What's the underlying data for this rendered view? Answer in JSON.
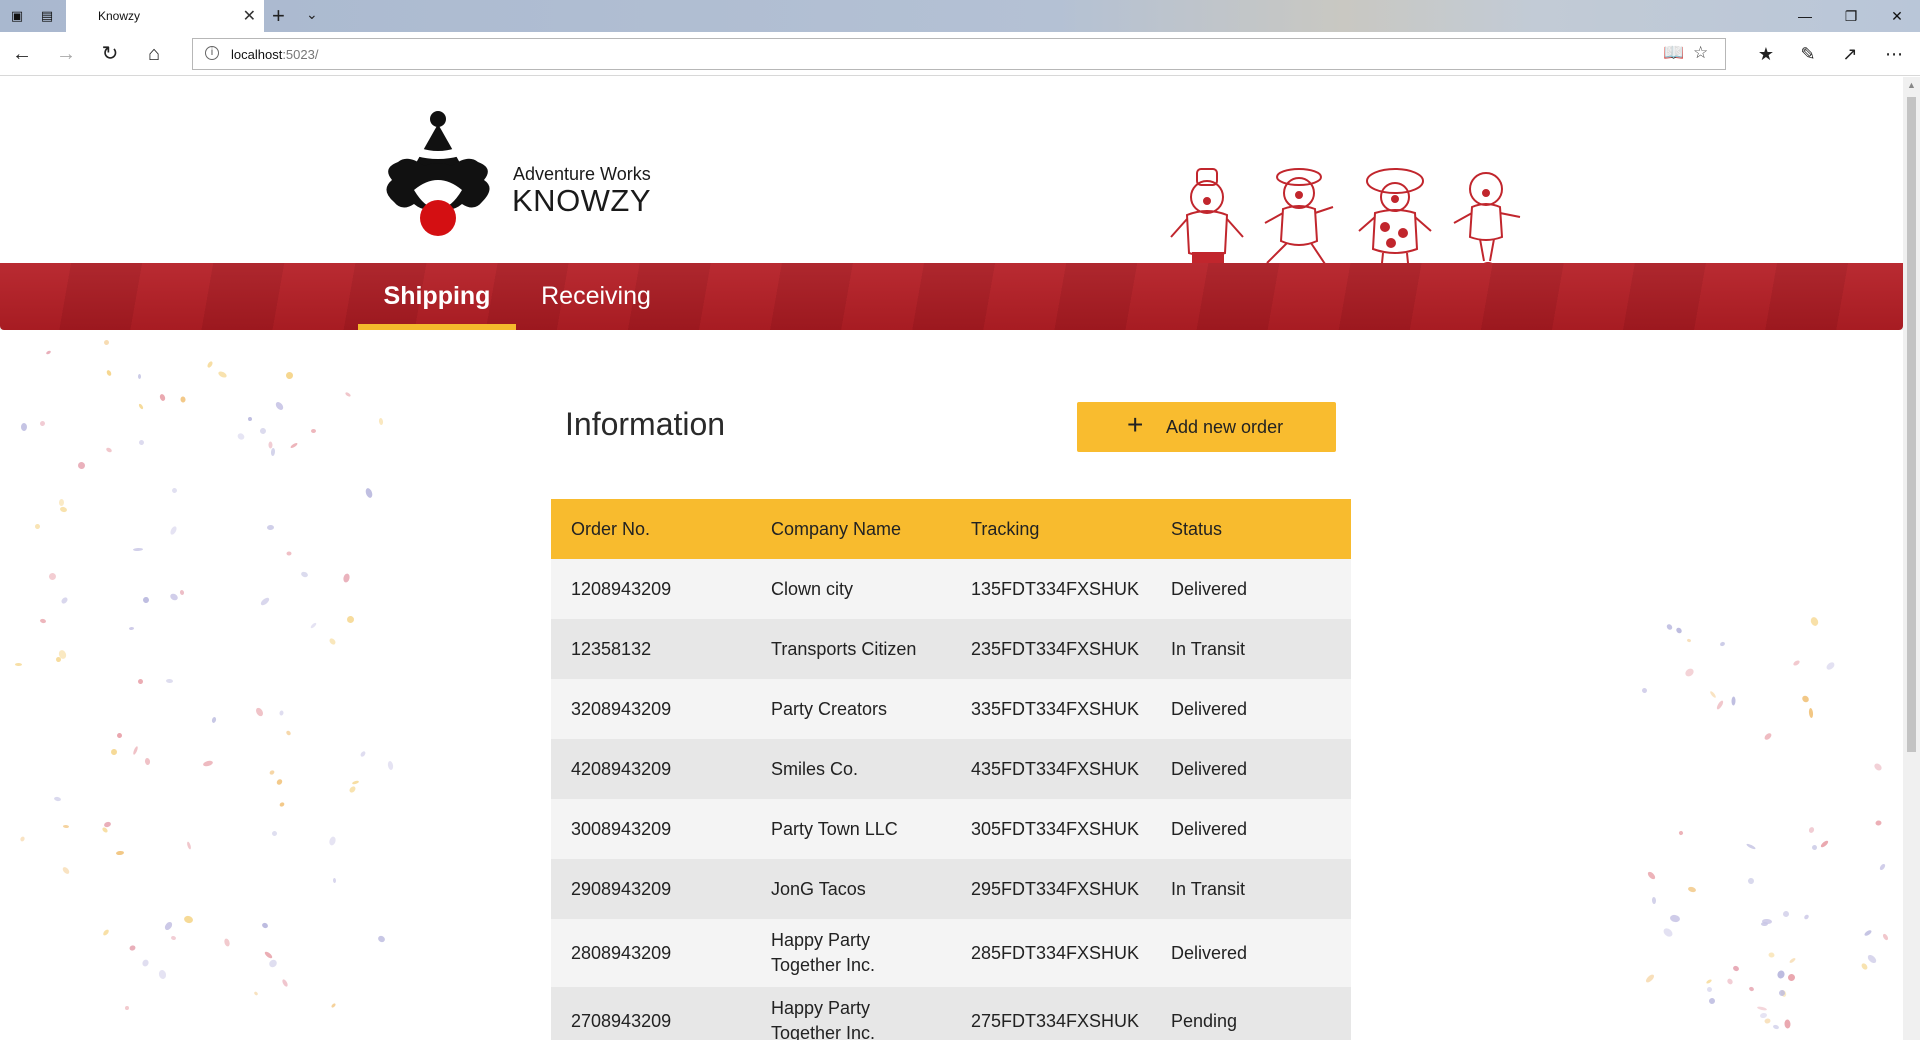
{
  "browser": {
    "tab_title": "Knowzy",
    "url_host": "localhost",
    "url_rest": ":5023/"
  },
  "brand": {
    "line1": "Adventure Works",
    "line2": "KNOWZY"
  },
  "nav": {
    "tabs": [
      {
        "label": "Shipping",
        "active": true
      },
      {
        "label": "Receiving",
        "active": false
      }
    ]
  },
  "main": {
    "heading": "Information",
    "add_button_label": "Add new order"
  },
  "table": {
    "columns": [
      "Order No.",
      "Company Name",
      "Tracking",
      "Status"
    ],
    "rows": [
      {
        "order": "1208943209",
        "company": "Clown city",
        "tracking": "135FDT334FXSHUK",
        "status": "Delivered"
      },
      {
        "order": "12358132",
        "company": "Transports Citizen",
        "tracking": "235FDT334FXSHUK",
        "status": "In Transit"
      },
      {
        "order": "3208943209",
        "company": "Party Creators",
        "tracking": "335FDT334FXSHUK",
        "status": "Delivered"
      },
      {
        "order": "4208943209",
        "company": "Smiles Co.",
        "tracking": "435FDT334FXSHUK",
        "status": "Delivered"
      },
      {
        "order": "3008943209",
        "company": "Party Town LLC",
        "tracking": "305FDT334FXSHUK",
        "status": "Delivered"
      },
      {
        "order": "2908943209",
        "company": "JonG Tacos",
        "tracking": "295FDT334FXSHUK",
        "status": "In Transit"
      },
      {
        "order": "2808943209",
        "company": "Happy Party Together Inc.",
        "tracking": "285FDT334FXSHUK",
        "status": "Delivered"
      },
      {
        "order": "2708943209",
        "company": "Happy Party Together Inc.",
        "tracking": "275FDT334FXSHUK",
        "status": "Pending"
      }
    ]
  },
  "colors": {
    "accent_yellow": "#f8bb2e",
    "band_red": "#b51e25",
    "row_light": "#f4f4f4",
    "row_dark": "#e7e7e7"
  }
}
